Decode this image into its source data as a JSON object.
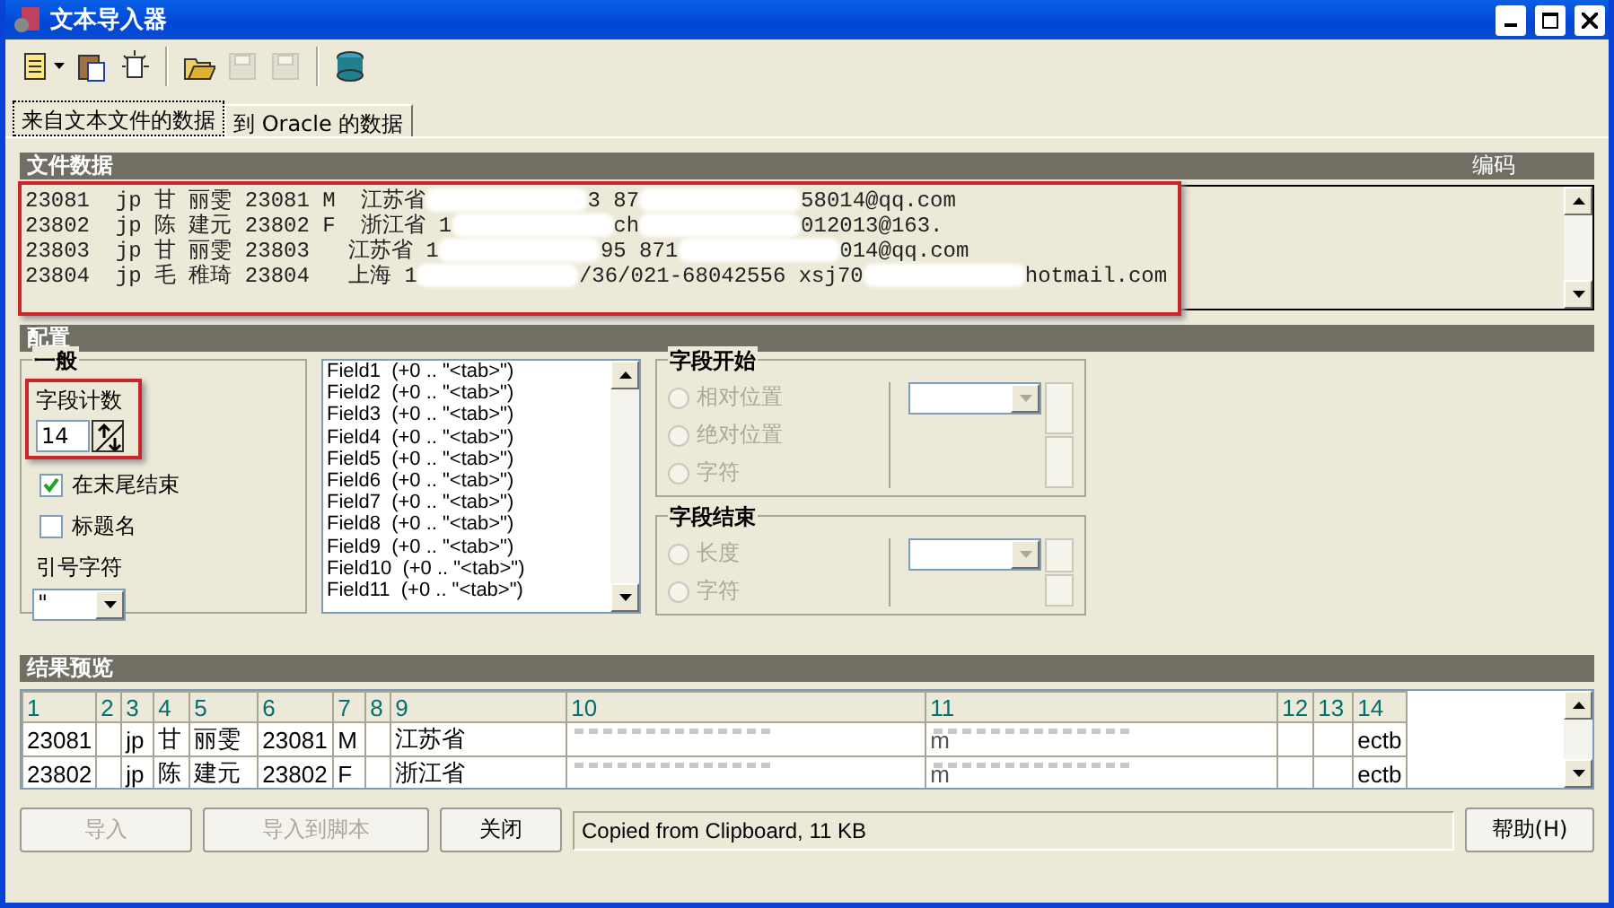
{
  "window": {
    "title": "文本导入器"
  },
  "toolbar": [
    {
      "kind": "document",
      "dropdown": true,
      "disabled": false
    },
    {
      "kind": "clipboard",
      "dropdown": false,
      "disabled": false
    },
    {
      "kind": "new",
      "dropdown": false,
      "disabled": false
    },
    {
      "kind": "open",
      "dropdown": false,
      "disabled": false,
      "group_start": true
    },
    {
      "kind": "save",
      "dropdown": false,
      "disabled": true
    },
    {
      "kind": "save-as",
      "dropdown": false,
      "disabled": true
    },
    {
      "kind": "database",
      "dropdown": false,
      "disabled": false,
      "group_start": true
    }
  ],
  "tabs": [
    {
      "label": "来自文本文件的数据",
      "selected": true
    },
    {
      "label": "到 Oracle 的数据",
      "selected": false
    }
  ],
  "file_data": {
    "title": "文件数据",
    "encoding_label": "编码",
    "lines": [
      [
        "23081  jp 甘 丽雯 23081 M  江苏省",
        "3 87",
        "58014@qq.com"
      ],
      [
        "23802  jp 陈 建元 23802 F  浙江省 1",
        "ch",
        "012013@163."
      ],
      [
        "23803  jp 甘 丽雯 23803   江苏省 1",
        "95 871",
        "014@qq.com"
      ],
      [
        "23804  jp 毛 稚琦 23804   上海 1",
        "/36/021-68042556 xsj70",
        "hotmail.com"
      ]
    ]
  },
  "config": {
    "title": "配置",
    "general": {
      "title": "一般",
      "field_count_label": "字段计数",
      "field_count": "14",
      "checkboxes": [
        {
          "label": "在末尾结束",
          "checked": true
        },
        {
          "label": "标题名",
          "checked": false
        }
      ],
      "quote_label": "引号字符",
      "quote_value": "\""
    },
    "fields": [
      "Field1  (+0 .. \"<tab>\")",
      "Field2  (+0 .. \"<tab>\")",
      "Field3  (+0 .. \"<tab>\")",
      "Field4  (+0 .. \"<tab>\")",
      "Field5  (+0 .. \"<tab>\")",
      "Field6  (+0 .. \"<tab>\")",
      "Field7  (+0 .. \"<tab>\")",
      "Field8  (+0 .. \"<tab>\")",
      "Field9  (+0 .. \"<tab>\")",
      "Field10  (+0 .. \"<tab>\")",
      "Field11  (+0 .. \"<tab>\")"
    ],
    "field_start": {
      "title": "字段开始",
      "options": [
        {
          "label": "相对位置",
          "selected": false,
          "disabled": true
        },
        {
          "label": "绝对位置",
          "selected": false,
          "disabled": true
        },
        {
          "label": "字符",
          "selected": false,
          "disabled": true
        }
      ]
    },
    "field_end": {
      "title": "字段结束",
      "options": [
        {
          "label": "长度",
          "selected": false,
          "disabled": true
        },
        {
          "label": "字符",
          "selected": false,
          "disabled": true
        }
      ]
    }
  },
  "preview": {
    "title": "结果预览",
    "columns": [
      "1",
      "2",
      "3",
      "4",
      "5",
      "6",
      "7",
      "8",
      "9",
      "10",
      "11",
      "12",
      "13",
      "14"
    ],
    "rows": [
      [
        {
          "text": "23081"
        },
        {},
        {
          "text": "jp"
        },
        {
          "text": "甘"
        },
        {
          "text": "丽雯"
        },
        {
          "text": "23081"
        },
        {
          "text": "M"
        },
        {},
        {
          "text": "江苏省"
        },
        {
          "redacted": true
        },
        {
          "redacted": true,
          "text": "m"
        },
        {},
        {},
        {
          "text": "ectb"
        }
      ],
      [
        {
          "text": "23802"
        },
        {},
        {
          "text": "jp"
        },
        {
          "text": "陈"
        },
        {
          "text": "建元"
        },
        {
          "text": "23802"
        },
        {
          "text": "F"
        },
        {},
        {
          "text": "浙江省"
        },
        {
          "redacted": true
        },
        {
          "redacted": true,
          "text": "m"
        },
        {},
        {},
        {
          "text": "ectb"
        }
      ]
    ]
  },
  "buttons": [
    {
      "label": "导入",
      "disabled": true
    },
    {
      "label": "导入到脚本",
      "disabled": true
    },
    {
      "label": "关闭",
      "disabled": false
    }
  ],
  "status": "Copied from Clipboard, 11 KB",
  "help_button": {
    "label": "帮助(H)",
    "disabled": false
  }
}
